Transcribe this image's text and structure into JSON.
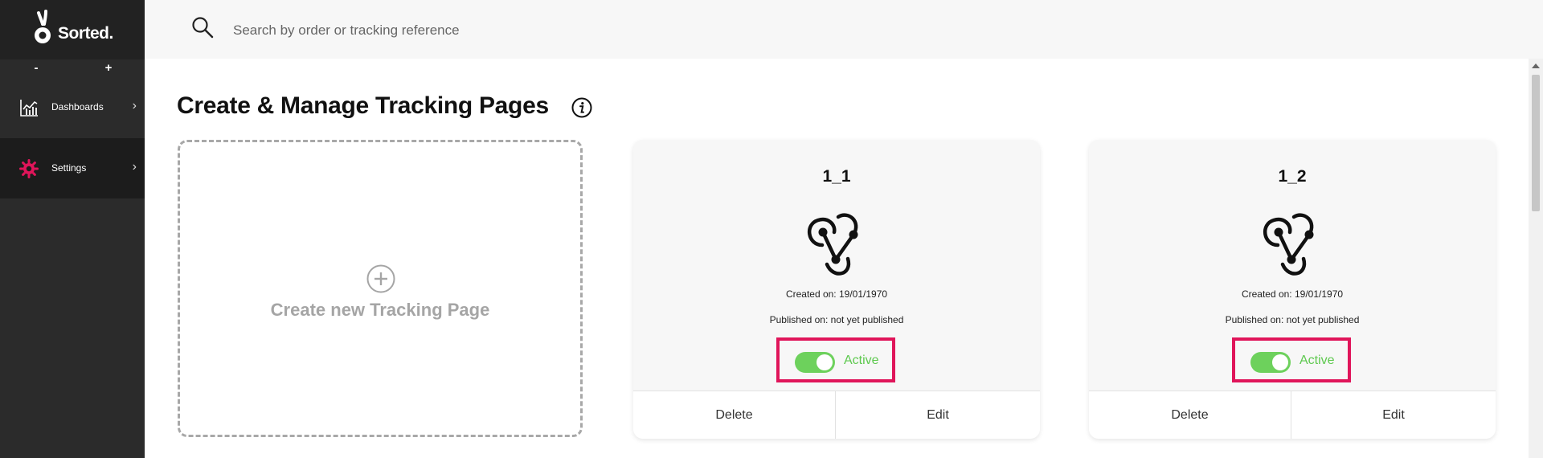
{
  "brand": {
    "name": "Sorted."
  },
  "sidebar": {
    "zoom_out": "-",
    "zoom_in": "+",
    "items": [
      {
        "label": "Dashboards",
        "icon": "chart-icon"
      },
      {
        "label": "Settings",
        "icon": "gear-icon",
        "active": true
      }
    ]
  },
  "search": {
    "placeholder": "Search by order or tracking reference",
    "value": ""
  },
  "page": {
    "title": "Create & Manage Tracking Pages",
    "create_label": "Create new Tracking Page"
  },
  "cards": [
    {
      "name": "1_1",
      "created": "Created on: 19/01/1970",
      "published": "Published on: not yet published",
      "status": "Active",
      "active": true,
      "delete_label": "Delete",
      "edit_label": "Edit"
    },
    {
      "name": "1_2",
      "created": "Created on: 19/01/1970",
      "published": "Published on: not yet published",
      "status": "Active",
      "active": true,
      "delete_label": "Delete",
      "edit_label": "Edit"
    }
  ],
  "colors": {
    "accent": "#e0155a",
    "toggle_on": "#6dd15c",
    "sidebar_bg": "#2b2b2b"
  }
}
